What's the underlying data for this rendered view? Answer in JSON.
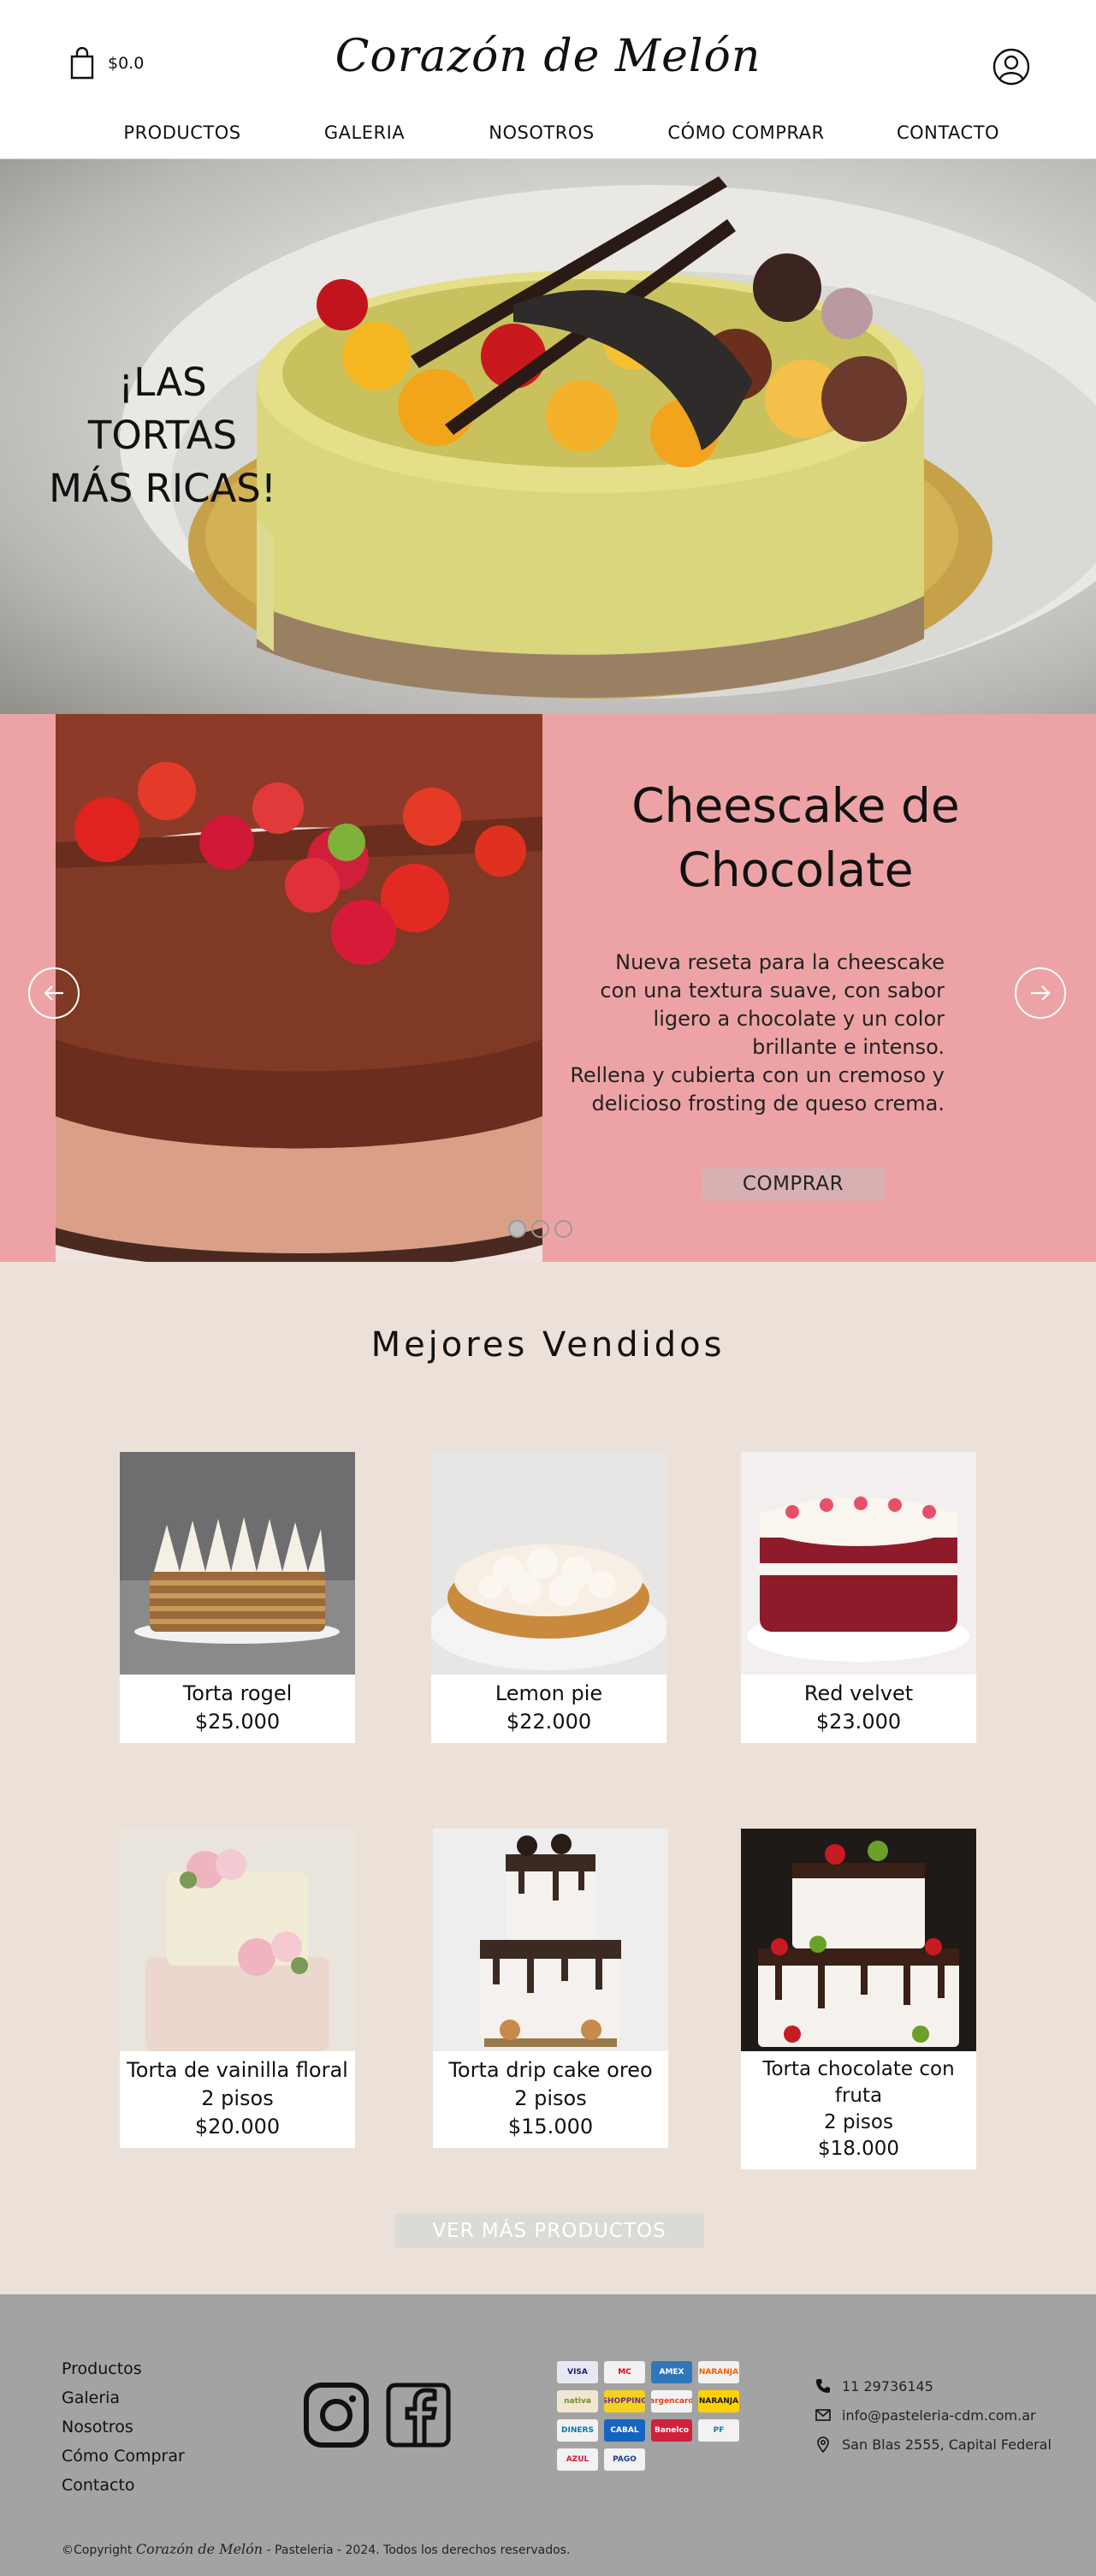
{
  "header": {
    "cart_amount": "$0.0",
    "logo": "Corazón de Melón",
    "nav": [
      "PRODUCTOS",
      "GALERIA",
      "NOSOTROS",
      "CÓMO COMPRAR",
      "CONTACTO"
    ]
  },
  "hero": {
    "title": "¡LAS TORTAS MÁS RICAS!"
  },
  "slider": {
    "title": "Cheescake de Chocolate",
    "description": "Nueva reseta para la cheescake\ncon una textura suave, con sabor\nligero a chocolate y un color\nbrillante e intenso.\nRellena y cubierta con un cremoso y\ndelicioso frosting de queso crema.",
    "button": "COMPRAR",
    "slide_count": 3,
    "active_slide": 1
  },
  "best_sellers": {
    "title": "Mejores Vendidos",
    "products": [
      {
        "lines": [
          "Torta rogel"
        ],
        "price": "$25.000"
      },
      {
        "lines": [
          "Lemon pie"
        ],
        "price": "$22.000"
      },
      {
        "lines": [
          "Red velvet"
        ],
        "price": "$23.000"
      },
      {
        "lines": [
          "Torta de vainilla floral",
          "2 pisos"
        ],
        "price": "$20.000"
      },
      {
        "lines": [
          "Torta drip cake oreo",
          "2 pisos"
        ],
        "price": "$15.000"
      },
      {
        "lines": [
          "Torta chocolate con fruta",
          "2 pisos"
        ],
        "price": "$18.000"
      }
    ],
    "more_button": "VER MÁS PRODUCTOS"
  },
  "footer": {
    "links": [
      "Productos",
      "Galeria",
      "Nosotros",
      "Cómo Comprar",
      "Contacto"
    ],
    "payment_methods": [
      {
        "name": "VISA",
        "color": "#e8e8f2",
        "text": "#1a1f71"
      },
      {
        "name": "MC",
        "color": "#f2f2f2",
        "text": "#eb001b"
      },
      {
        "name": "AMEX",
        "color": "#2e77bc",
        "text": "#ffffff"
      },
      {
        "name": "NARANJA",
        "color": "#f2f2f2",
        "text": "#ff5a00"
      },
      {
        "name": "nativa",
        "color": "#f0e6d2",
        "text": "#6a8f2a"
      },
      {
        "name": "SHOPPING",
        "color": "#f5d21f",
        "text": "#6b2d8c"
      },
      {
        "name": "argencard",
        "color": "#f2f2f2",
        "text": "#e0401a"
      },
      {
        "name": "NARANJA",
        "color": "#ffd200",
        "text": "#1a1a1a"
      },
      {
        "name": "DINERS",
        "color": "#f2f2f2",
        "text": "#0079be"
      },
      {
        "name": "CABAL",
        "color": "#1565c0",
        "text": "#ffffff"
      },
      {
        "name": "Banelco",
        "color": "#d1203c",
        "text": "#ffffff"
      },
      {
        "name": "PF",
        "color": "#f2f2f2",
        "text": "#0b7fc1"
      },
      {
        "name": "AZUL",
        "color": "#f2f2f2",
        "text": "#e2172b"
      },
      {
        "name": "PAGO",
        "color": "#f2f2f2",
        "text": "#1d3e8a"
      }
    ],
    "phone": "11 29736145",
    "email": "info@pasteleria-cdm.com.ar",
    "address": "San Blas 2555, Capital Federal",
    "copyright_prefix": "©Copyright",
    "copyright_brand": "Corazón de Melón",
    "copyright_suffix": "- Pasteleria - 2024. Todos los derechos reservados."
  },
  "colors": {
    "slider_bg": "#eda3a5",
    "best_bg": "#ece1d8",
    "footer_bg": "#a3a3a3"
  }
}
